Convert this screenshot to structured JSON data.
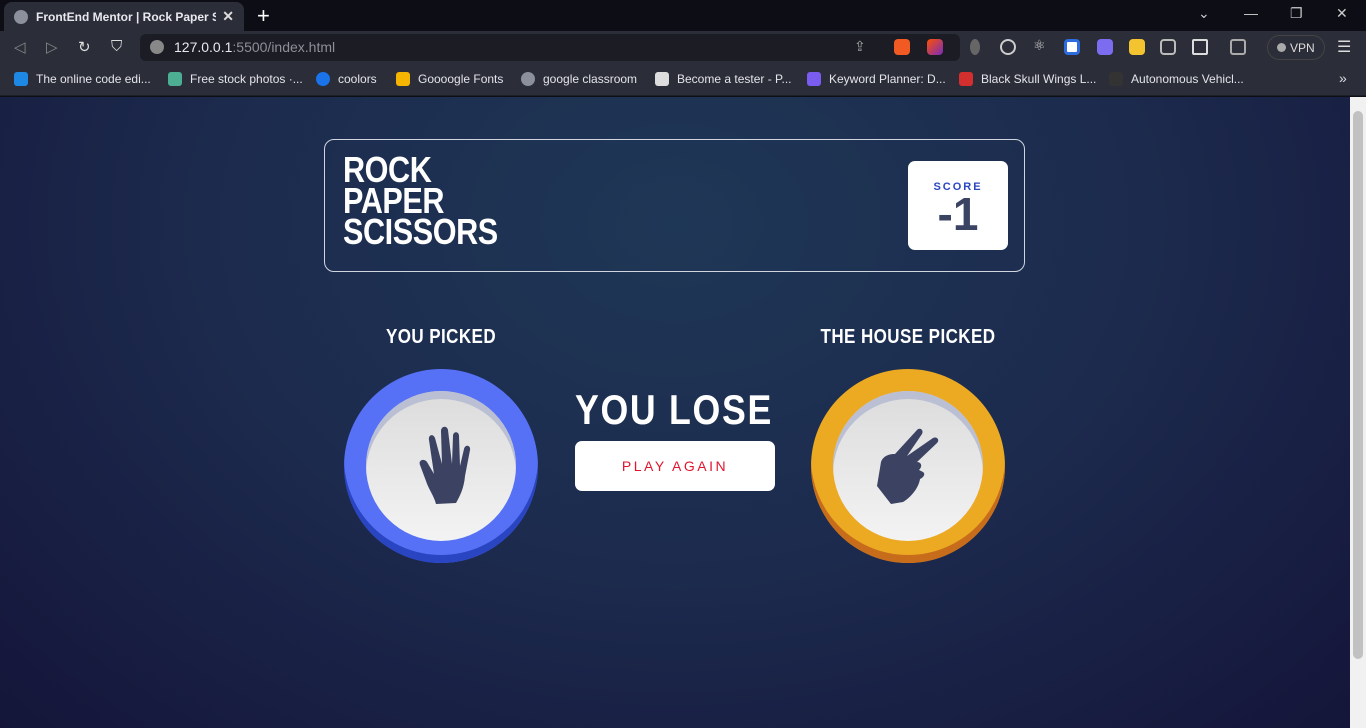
{
  "browser": {
    "tab_title": "FrontEnd Mentor | Rock Paper Scissors",
    "url_host": "127.0.0.1",
    "url_rest": ":5500/index.html",
    "vpn_label": "VPN",
    "bookmarks": [
      {
        "label": "The online code edi...",
        "color": "#1e88e5"
      },
      {
        "label": "Free stock photos ·...",
        "color": "#4caf94"
      },
      {
        "label": "coolors",
        "color": "#1a73e8"
      },
      {
        "label": "Goooogle Fonts",
        "color": "#f4b400"
      },
      {
        "label": "google classroom",
        "color": "#8c8f9c"
      },
      {
        "label": "Become a tester - P...",
        "color": "#dddddd"
      },
      {
        "label": "Keyword Planner: D...",
        "color": "#7b5cf0"
      },
      {
        "label": "Black Skull Wings L...",
        "color": "#d32f2f"
      },
      {
        "label": "Autonomous Vehicl...",
        "color": "#333333"
      }
    ]
  },
  "game": {
    "title_lines": [
      "ROCK",
      "PAPER",
      "SCISSORS"
    ],
    "score_label": "SCORE",
    "score_value": "-1",
    "player_label": "YOU PICKED",
    "house_label": "THE HOUSE PICKED",
    "player_choice": "paper",
    "house_choice": "scissors",
    "result": "YOU LOSE",
    "play_again": "PLAY AGAIN",
    "colors": {
      "paper": "#5671f5",
      "scissors": "#eca922",
      "play_again_text": "#e0162f",
      "score_text": "#3b4363"
    }
  }
}
